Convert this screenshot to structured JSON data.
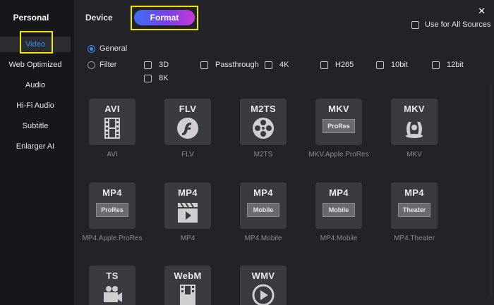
{
  "sidebar": {
    "title": "Personal",
    "items": [
      {
        "label": "Video",
        "active": true
      },
      {
        "label": "Web Optimized"
      },
      {
        "label": "Audio"
      },
      {
        "label": "Hi-Fi Audio"
      },
      {
        "label": "Subtitle"
      },
      {
        "label": "Enlarger AI"
      }
    ]
  },
  "tabs": {
    "device": "Device",
    "format": "Format"
  },
  "use_all_sources": "Use for All Sources",
  "mode": {
    "general": "General",
    "filter": "Filter"
  },
  "filters": [
    "3D",
    "Passthrough",
    "4K",
    "H265",
    "10bit",
    "12bit",
    "8K"
  ],
  "formats": [
    {
      "name": "AVI",
      "icon": "film-icon",
      "label": "AVI"
    },
    {
      "name": "FLV",
      "icon": "flash-icon",
      "label": "FLV"
    },
    {
      "name": "M2TS",
      "icon": "film-reel-icon",
      "label": "M2TS"
    },
    {
      "name": "MKV",
      "badge": "ProRes",
      "label": "MKV.Apple.ProRes"
    },
    {
      "name": "MKV",
      "icon": "matroska-icon",
      "label": "MKV"
    },
    {
      "name": "MP4",
      "badge": "ProRes",
      "label": "MP4.Apple.ProRes"
    },
    {
      "name": "MP4",
      "icon": "clapper-play-icon",
      "label": "MP4"
    },
    {
      "name": "MP4",
      "badge": "Mobile",
      "label": "MP4.Mobile"
    },
    {
      "name": "MP4",
      "badge": "Mobile",
      "label": "MP4.Mobile"
    },
    {
      "name": "MP4",
      "badge": "Theater",
      "label": "MP4.Theater"
    },
    {
      "name": "TS",
      "icon": "camera-icon",
      "label": ""
    },
    {
      "name": "WebM",
      "icon": "film-icon",
      "label": ""
    },
    {
      "name": "WMV",
      "icon": "play-circle-icon",
      "label": ""
    }
  ],
  "colors": {
    "accent": "#3a8fe8",
    "highlight": "#f3e600",
    "gradient_start": "#3c6ff2",
    "gradient_end": "#c53ad8"
  }
}
